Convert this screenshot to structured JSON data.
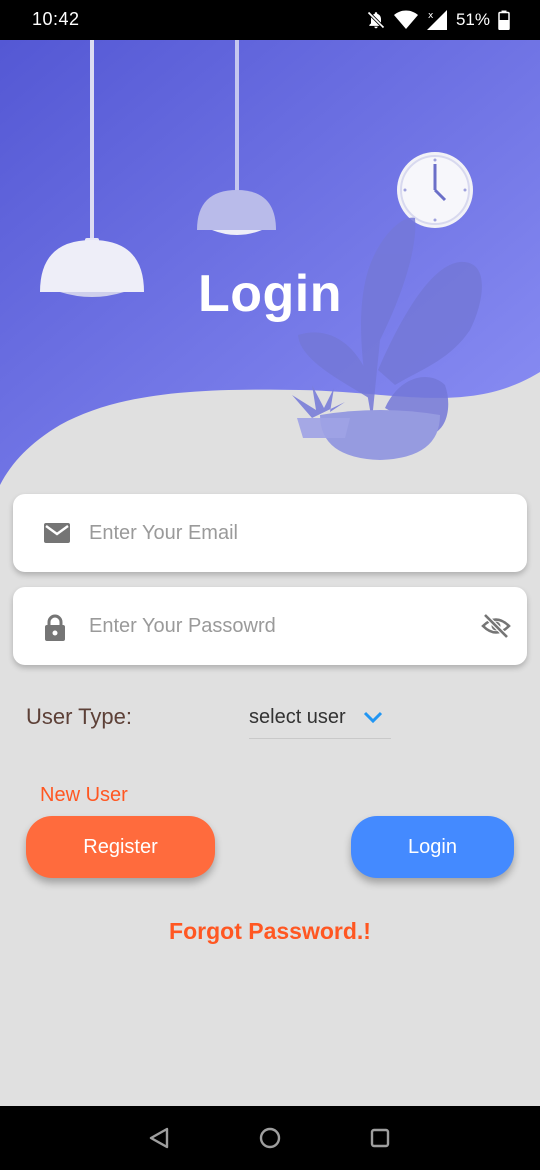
{
  "status_bar": {
    "time": "10:42",
    "battery_percent": "51%",
    "icons": [
      "notifications-off-icon",
      "wifi-icon",
      "cell-signal-icon",
      "battery-icon"
    ]
  },
  "hero": {
    "title": "Login",
    "gradient_colors": [
      "#5458d4",
      "#8c90f5"
    ],
    "illustration": [
      "pendant-lamp",
      "pendant-lamp",
      "wall-clock",
      "potted-plant",
      "small-plant"
    ]
  },
  "form": {
    "email": {
      "placeholder": "Enter Your Email",
      "value": "",
      "icon": "mail-icon"
    },
    "password": {
      "placeholder": "Enter Your Passowrd",
      "value": "",
      "icon": "lock-icon",
      "toggle_icon": "visibility-off-icon"
    },
    "user_type": {
      "label": "User Type:",
      "selected": "select user"
    }
  },
  "actions": {
    "new_user_label": "New User",
    "register_label": "Register",
    "login_label": "Login",
    "forgot_label": "Forgot Password.!"
  },
  "nav_bar": {
    "buttons": [
      "back-icon",
      "home-icon",
      "recents-icon"
    ]
  },
  "colors": {
    "accent_orange": "#ff5722",
    "register_button": "#ff6b3d",
    "login_button": "#448aff",
    "background": "#e0e0e0"
  }
}
